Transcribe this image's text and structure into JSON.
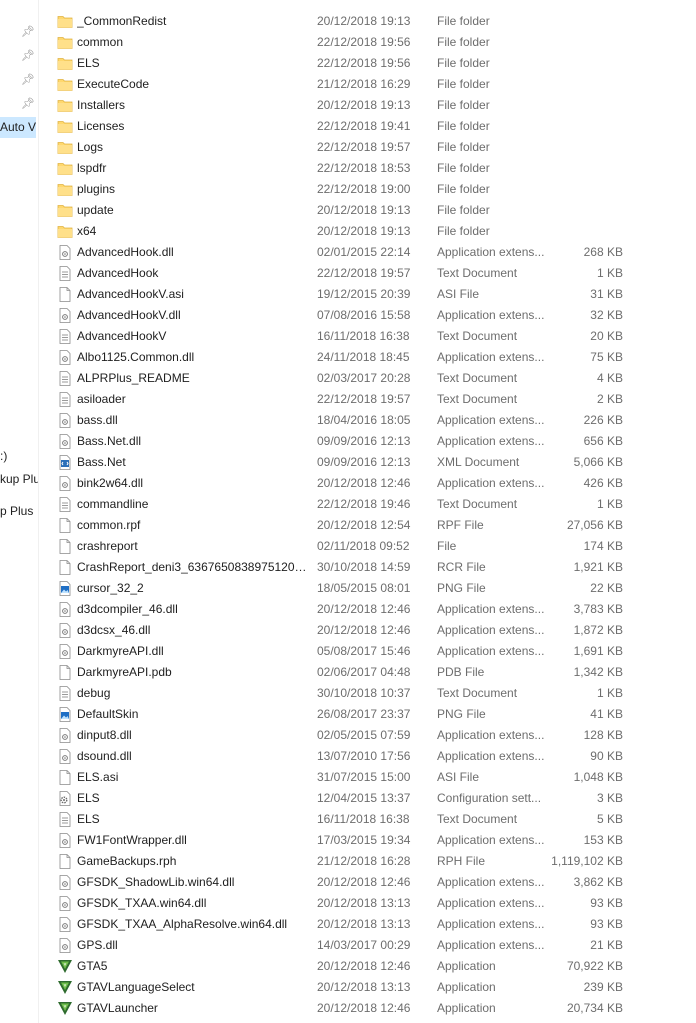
{
  "nav": {
    "items": [
      {
        "label": "Auto V",
        "selected": true
      },
      {
        "label": ":)",
        "selected": false
      },
      {
        "label": "kup Plu",
        "selected": false
      },
      {
        "label": "p Plus",
        "selected": false
      }
    ]
  },
  "files": [
    {
      "name": "_CommonRedist",
      "date": "20/12/2018 19:13",
      "type": "File folder",
      "size": "",
      "icon": "folder-icon"
    },
    {
      "name": "common",
      "date": "22/12/2018 19:56",
      "type": "File folder",
      "size": "",
      "icon": "folder-icon"
    },
    {
      "name": "ELS",
      "date": "22/12/2018 19:56",
      "type": "File folder",
      "size": "",
      "icon": "folder-icon"
    },
    {
      "name": "ExecuteCode",
      "date": "21/12/2018 16:29",
      "type": "File folder",
      "size": "",
      "icon": "folder-icon"
    },
    {
      "name": "Installers",
      "date": "20/12/2018 19:13",
      "type": "File folder",
      "size": "",
      "icon": "folder-icon"
    },
    {
      "name": "Licenses",
      "date": "22/12/2018 19:41",
      "type": "File folder",
      "size": "",
      "icon": "folder-icon"
    },
    {
      "name": "Logs",
      "date": "22/12/2018 19:57",
      "type": "File folder",
      "size": "",
      "icon": "folder-icon"
    },
    {
      "name": "lspdfr",
      "date": "22/12/2018 18:53",
      "type": "File folder",
      "size": "",
      "icon": "folder-icon"
    },
    {
      "name": "plugins",
      "date": "22/12/2018 19:00",
      "type": "File folder",
      "size": "",
      "icon": "folder-icon"
    },
    {
      "name": "update",
      "date": "20/12/2018 19:13",
      "type": "File folder",
      "size": "",
      "icon": "folder-icon"
    },
    {
      "name": "x64",
      "date": "20/12/2018 19:13",
      "type": "File folder",
      "size": "",
      "icon": "folder-icon"
    },
    {
      "name": "AdvancedHook.dll",
      "date": "02/01/2015 22:14",
      "type": "Application extens...",
      "size": "268 KB",
      "icon": "dll-file-icon"
    },
    {
      "name": "AdvancedHook",
      "date": "22/12/2018 19:57",
      "type": "Text Document",
      "size": "1 KB",
      "icon": "text-file-icon"
    },
    {
      "name": "AdvancedHookV.asi",
      "date": "19/12/2015 20:39",
      "type": "ASI File",
      "size": "31 KB",
      "icon": "blank-file-icon"
    },
    {
      "name": "AdvancedHookV.dll",
      "date": "07/08/2016 15:58",
      "type": "Application extens...",
      "size": "32 KB",
      "icon": "dll-file-icon"
    },
    {
      "name": "AdvancedHookV",
      "date": "16/11/2018 16:38",
      "type": "Text Document",
      "size": "20 KB",
      "icon": "text-file-icon"
    },
    {
      "name": "Albo1125.Common.dll",
      "date": "24/11/2018 18:45",
      "type": "Application extens...",
      "size": "75 KB",
      "icon": "dll-file-icon"
    },
    {
      "name": "ALPRPlus_README",
      "date": "02/03/2017 20:28",
      "type": "Text Document",
      "size": "4 KB",
      "icon": "text-file-icon"
    },
    {
      "name": "asiloader",
      "date": "22/12/2018 19:57",
      "type": "Text Document",
      "size": "2 KB",
      "icon": "text-file-icon"
    },
    {
      "name": "bass.dll",
      "date": "18/04/2016 18:05",
      "type": "Application extens...",
      "size": "226 KB",
      "icon": "dll-file-icon"
    },
    {
      "name": "Bass.Net.dll",
      "date": "09/09/2016 12:13",
      "type": "Application extens...",
      "size": "656 KB",
      "icon": "dll-file-icon"
    },
    {
      "name": "Bass.Net",
      "date": "09/09/2016 12:13",
      "type": "XML Document",
      "size": "5,066 KB",
      "icon": "xml-file-icon"
    },
    {
      "name": "bink2w64.dll",
      "date": "20/12/2018 12:46",
      "type": "Application extens...",
      "size": "426 KB",
      "icon": "dll-file-icon"
    },
    {
      "name": "commandline",
      "date": "22/12/2018 19:46",
      "type": "Text Document",
      "size": "1 KB",
      "icon": "text-file-icon"
    },
    {
      "name": "common.rpf",
      "date": "20/12/2018 12:54",
      "type": "RPF File",
      "size": "27,056 KB",
      "icon": "blank-file-icon"
    },
    {
      "name": "crashreport",
      "date": "02/11/2018 09:52",
      "type": "File",
      "size": "174 KB",
      "icon": "blank-file-icon"
    },
    {
      "name": "CrashReport_deni3_636765083897512014....",
      "date": "30/10/2018 14:59",
      "type": "RCR File",
      "size": "1,921 KB",
      "icon": "blank-file-icon"
    },
    {
      "name": "cursor_32_2",
      "date": "18/05/2015 08:01",
      "type": "PNG File",
      "size": "22 KB",
      "icon": "image-file-icon"
    },
    {
      "name": "d3dcompiler_46.dll",
      "date": "20/12/2018 12:46",
      "type": "Application extens...",
      "size": "3,783 KB",
      "icon": "dll-file-icon"
    },
    {
      "name": "d3dcsx_46.dll",
      "date": "20/12/2018 12:46",
      "type": "Application extens...",
      "size": "1,872 KB",
      "icon": "dll-file-icon"
    },
    {
      "name": "DarkmyreAPI.dll",
      "date": "05/08/2017 15:46",
      "type": "Application extens...",
      "size": "1,691 KB",
      "icon": "dll-file-icon"
    },
    {
      "name": "DarkmyreAPI.pdb",
      "date": "02/06/2017 04:48",
      "type": "PDB File",
      "size": "1,342 KB",
      "icon": "blank-file-icon"
    },
    {
      "name": "debug",
      "date": "30/10/2018 10:37",
      "type": "Text Document",
      "size": "1 KB",
      "icon": "text-file-icon"
    },
    {
      "name": "DefaultSkin",
      "date": "26/08/2017 23:37",
      "type": "PNG File",
      "size": "41 KB",
      "icon": "image-file-icon"
    },
    {
      "name": "dinput8.dll",
      "date": "02/05/2015 07:59",
      "type": "Application extens...",
      "size": "128 KB",
      "icon": "dll-file-icon"
    },
    {
      "name": "dsound.dll",
      "date": "13/07/2010 17:56",
      "type": "Application extens...",
      "size": "90 KB",
      "icon": "dll-file-icon"
    },
    {
      "name": "ELS.asi",
      "date": "31/07/2015 15:00",
      "type": "ASI File",
      "size": "1,048 KB",
      "icon": "blank-file-icon"
    },
    {
      "name": "ELS",
      "date": "12/04/2015 13:37",
      "type": "Configuration sett...",
      "size": "3 KB",
      "icon": "config-file-icon"
    },
    {
      "name": "ELS",
      "date": "16/11/2018 16:38",
      "type": "Text Document",
      "size": "5 KB",
      "icon": "text-file-icon"
    },
    {
      "name": "FW1FontWrapper.dll",
      "date": "17/03/2015 19:34",
      "type": "Application extens...",
      "size": "153 KB",
      "icon": "dll-file-icon"
    },
    {
      "name": "GameBackups.rph",
      "date": "21/12/2018 16:28",
      "type": "RPH File",
      "size": "1,119,102 KB",
      "icon": "blank-file-icon"
    },
    {
      "name": "GFSDK_ShadowLib.win64.dll",
      "date": "20/12/2018 12:46",
      "type": "Application extens...",
      "size": "3,862 KB",
      "icon": "dll-file-icon"
    },
    {
      "name": "GFSDK_TXAA.win64.dll",
      "date": "20/12/2018 13:13",
      "type": "Application extens...",
      "size": "93 KB",
      "icon": "dll-file-icon"
    },
    {
      "name": "GFSDK_TXAA_AlphaResolve.win64.dll",
      "date": "20/12/2018 13:13",
      "type": "Application extens...",
      "size": "93 KB",
      "icon": "dll-file-icon"
    },
    {
      "name": "GPS.dll",
      "date": "14/03/2017 00:29",
      "type": "Application extens...",
      "size": "21 KB",
      "icon": "dll-file-icon"
    },
    {
      "name": "GTA5",
      "date": "20/12/2018 12:46",
      "type": "Application",
      "size": "70,922 KB",
      "icon": "gta-app-icon"
    },
    {
      "name": "GTAVLanguageSelect",
      "date": "20/12/2018 13:13",
      "type": "Application",
      "size": "239 KB",
      "icon": "gta-app-icon"
    },
    {
      "name": "GTAVLauncher",
      "date": "20/12/2018 12:46",
      "type": "Application",
      "size": "20,734 KB",
      "icon": "gta-app-icon"
    }
  ]
}
